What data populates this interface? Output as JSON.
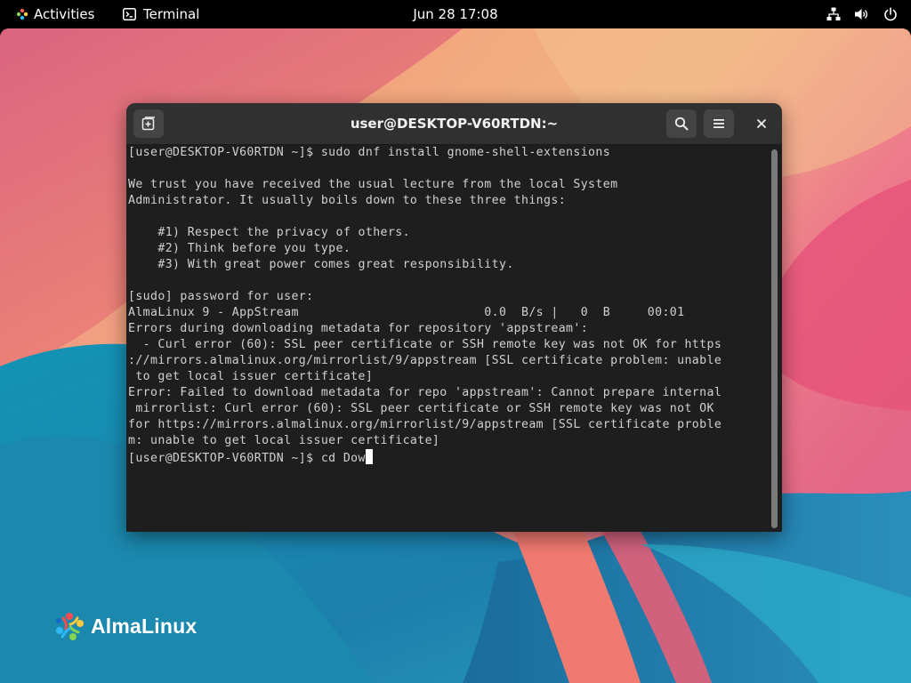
{
  "topbar": {
    "activities_label": "Activities",
    "app_name": "Terminal",
    "clock": "Jun 28  17:08",
    "tray_icons": [
      "network-icon",
      "volume-icon",
      "power-icon"
    ]
  },
  "desktop": {
    "brand_label": "AlmaLinux",
    "colors": {
      "coral": "#f07a70",
      "pink": "#e8557a",
      "teal": "#1a8fa8",
      "blue": "#1b6fa0"
    }
  },
  "terminal": {
    "title": "user@DESKTOP-V60RTDN:~",
    "lines": [
      "[user@DESKTOP-V60RTDN ~]$ sudo dnf install gnome-shell-extensions",
      "",
      "We trust you have received the usual lecture from the local System",
      "Administrator. It usually boils down to these three things:",
      "",
      "    #1) Respect the privacy of others.",
      "    #2) Think before you type.",
      "    #3) With great power comes great responsibility.",
      "",
      "[sudo] password for user:",
      "AlmaLinux 9 - AppStream                         0.0  B/s |   0  B     00:01",
      "Errors during downloading metadata for repository 'appstream':",
      "  - Curl error (60): SSL peer certificate or SSH remote key was not OK for https",
      "://mirrors.almalinux.org/mirrorlist/9/appstream [SSL certificate problem: unable",
      " to get local issuer certificate]",
      "Error: Failed to download metadata for repo 'appstream': Cannot prepare internal",
      " mirrorlist: Curl error (60): SSL peer certificate or SSH remote key was not OK",
      "for https://mirrors.almalinux.org/mirrorlist/9/appstream [SSL certificate proble",
      "m: unable to get local issuer certificate]"
    ],
    "prompt_line": "[user@DESKTOP-V60RTDN ~]$ cd Dow"
  }
}
